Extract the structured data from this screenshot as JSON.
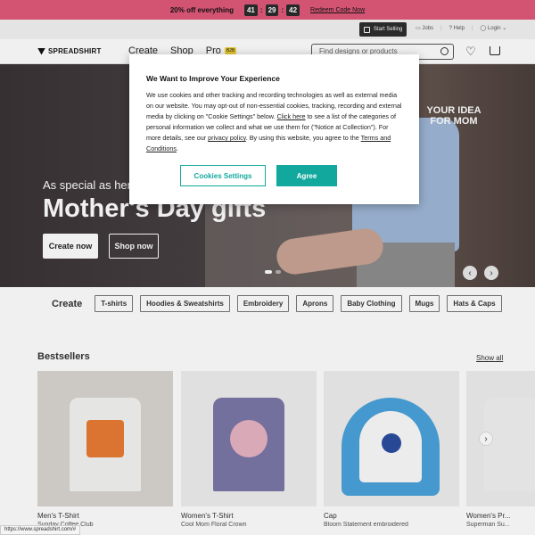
{
  "promo": {
    "text": "20% off everything",
    "timer": [
      "41",
      "29",
      "42"
    ],
    "redeem": "Redeem Code Now"
  },
  "utility": {
    "start_selling": "Start Selling",
    "jobs": "Jobs",
    "help": "Help",
    "login": "Login"
  },
  "nav": {
    "logo": "SPREADSHIRT",
    "links": [
      "Create",
      "Shop",
      "Pro"
    ],
    "b2b_badge": "B2B",
    "search_placeholder": "Find designs or products"
  },
  "hero": {
    "tag": "YOUR IDEA FOR MOM",
    "subtitle": "As special as her",
    "title": "Mother's Day gifts",
    "create_now": "Create now",
    "shop_now": "Shop now"
  },
  "create": {
    "label": "Create",
    "chips": [
      "T-shirts",
      "Hoodies & Sweatshirts",
      "Embroidery",
      "Aprons",
      "Baby Clothing",
      "Mugs",
      "Hats & Caps"
    ]
  },
  "bestsellers": {
    "title": "Bestsellers",
    "show_all": "Show all",
    "products": [
      {
        "category": "Men's T-Shirt",
        "name": "Sunday Coffee Club"
      },
      {
        "category": "Women's T-Shirt",
        "name": "Cool Mom Floral Crown"
      },
      {
        "category": "Cap",
        "name": "Bloom Statement embroidered"
      },
      {
        "category": "Women's Pr...",
        "name": "Superman Su..."
      }
    ]
  },
  "cookie": {
    "title": "We Want to Improve Your Experience",
    "body_1": "We use cookies and other tracking and recording technologies as well as external media on our website. You may opt-out of non-essential cookies, tracking, recording and external media by clicking on \"Cookie Settings\" below. ",
    "link_click_here": "Click here",
    "body_2": " to see a list of the categories of personal information we collect and what we use them for (\"Notice at Collection\"). For more details, see our ",
    "link_privacy": "privacy policy",
    "body_3": ". By using this website, you agree to the ",
    "link_terms": "Terms and Conditions",
    "body_4": ".",
    "settings_button": "Cookies Settings",
    "agree_button": "Agree"
  },
  "status_url": "https://www.spreadshirt.com/#",
  "colors": {
    "promo": "#e05a7a",
    "accent": "#13a89e"
  }
}
